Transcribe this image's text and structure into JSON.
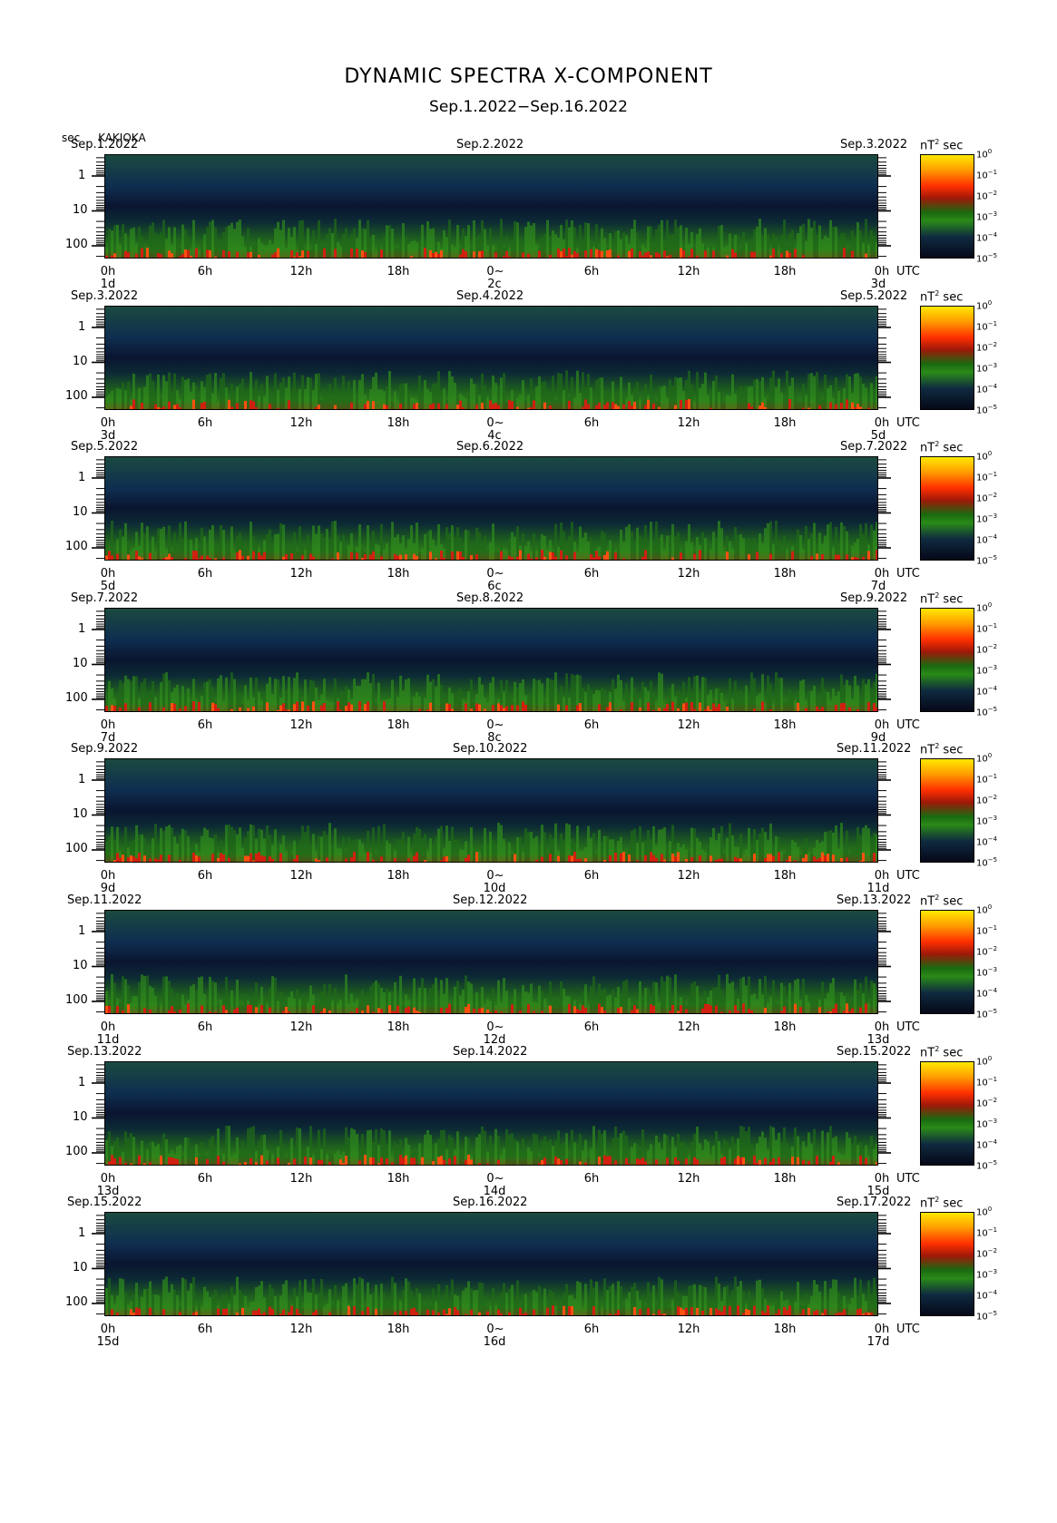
{
  "title": "DYNAMIC SPECTRA X-COMPONENT",
  "subtitle": "Sep.1.2022−Sep.16.2022",
  "y_unit": "sec",
  "station": "KAKIOKA",
  "colorbar_unit": "nT",
  "colorbar_unit_sup": "2",
  "colorbar_unit_tail": "sec",
  "colorbar_labels": [
    "10",
    "10",
    "10",
    "10",
    "10",
    "10"
  ],
  "colorbar_exps": [
    "0",
    "−1",
    "−2",
    "−3",
    "−4",
    "−5"
  ],
  "ytick_labels": [
    "1",
    "10",
    "100"
  ],
  "xtick_labels": [
    "0h",
    "6h",
    "12h",
    "18h",
    "0~",
    "6h",
    "12h",
    "18h",
    "0h"
  ],
  "utc_label": "UTC",
  "panels": [
    {
      "left_date": "Sep.1.2022",
      "mid_date": "Sep.2.2022",
      "right_date": "Sep.3.2022",
      "day_start": "1d",
      "day_mid": "2c",
      "day_end": "3d"
    },
    {
      "left_date": "Sep.3.2022",
      "mid_date": "Sep.4.2022",
      "right_date": "Sep.5.2022",
      "day_start": "3d",
      "day_mid": "4c",
      "day_end": "5d"
    },
    {
      "left_date": "Sep.5.2022",
      "mid_date": "Sep.6.2022",
      "right_date": "Sep.7.2022",
      "day_start": "5d",
      "day_mid": "6c",
      "day_end": "7d"
    },
    {
      "left_date": "Sep.7.2022",
      "mid_date": "Sep.8.2022",
      "right_date": "Sep.9.2022",
      "day_start": "7d",
      "day_mid": "8c",
      "day_end": "9d"
    },
    {
      "left_date": "Sep.9.2022",
      "mid_date": "Sep.10.2022",
      "right_date": "Sep.11.2022",
      "day_start": "9d",
      "day_mid": "10d",
      "day_end": "11d"
    },
    {
      "left_date": "Sep.11.2022",
      "mid_date": "Sep.12.2022",
      "right_date": "Sep.13.2022",
      "day_start": "11d",
      "day_mid": "12d",
      "day_end": "13d"
    },
    {
      "left_date": "Sep.13.2022",
      "mid_date": "Sep.14.2022",
      "right_date": "Sep.15.2022",
      "day_start": "13d",
      "day_mid": "14d",
      "day_end": "15d"
    },
    {
      "left_date": "Sep.15.2022",
      "mid_date": "Sep.16.2022",
      "right_date": "Sep.17.2022",
      "day_start": "15d",
      "day_mid": "16d",
      "day_end": "17d"
    }
  ],
  "chart_data": {
    "type": "heatmap",
    "x_unit": "UTC hours (two days per panel)",
    "y_axis": "period (sec), log scale, 100 at bottom to ~0.3 at top",
    "color_scale": "power nT^2 sec, 10^-5 to 10^0, log",
    "colormap": [
      "#050818",
      "#0f2a40",
      "#2a8a18",
      "#a01808",
      "#ff3000",
      "#ffa000",
      "#ffe800"
    ]
  }
}
